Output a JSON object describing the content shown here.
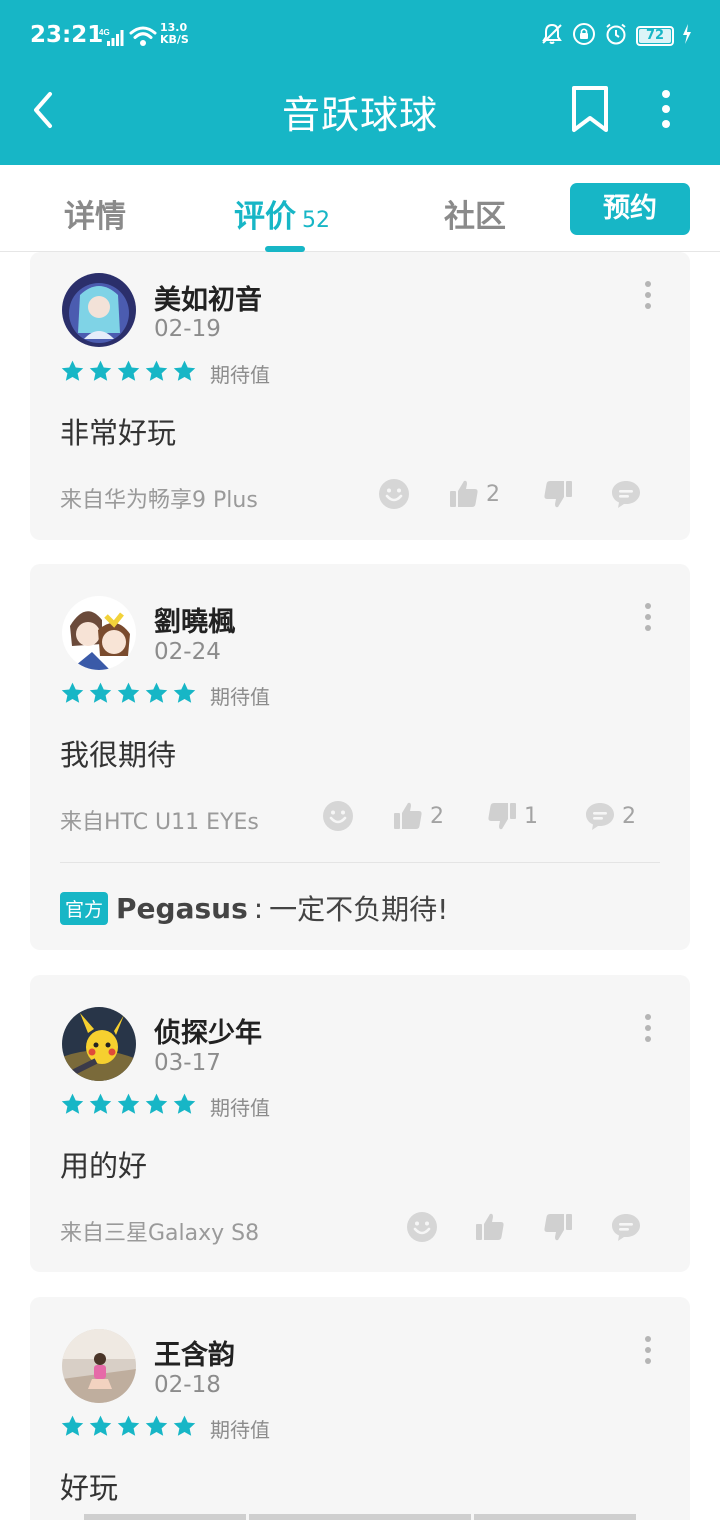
{
  "status_bar": {
    "time": "23:21",
    "network": "4G",
    "speed_value": "13.0",
    "speed_unit": "KB/S",
    "battery": "72"
  },
  "app_bar": {
    "title": "音跃球球"
  },
  "tabs": {
    "details": "详情",
    "reviews": "评价",
    "reviews_count": "52",
    "community": "社区",
    "reserve_button": "预约"
  },
  "reviews": [
    {
      "username": "美如初音",
      "date": "02-19",
      "rating": 5,
      "rating_label": "期待值",
      "text": "非常好玩",
      "device": "来自华为畅享9 Plus",
      "likes": "2",
      "dislikes": "",
      "comments": ""
    },
    {
      "username": "劉曉楓",
      "date": "02-24",
      "rating": 5,
      "rating_label": "期待值",
      "text": "我很期待",
      "device": "来自HTC U11 EYEs",
      "likes": "2",
      "dislikes": "1",
      "comments": "2",
      "official_reply": {
        "badge": "官方",
        "author": "Pegasus",
        "separator": ":",
        "text": "一定不负期待!"
      }
    },
    {
      "username": "侦探少年",
      "date": "03-17",
      "rating": 5,
      "rating_label": "期待值",
      "text": "用的好",
      "device": "来自三星Galaxy S8",
      "likes": "",
      "dislikes": "",
      "comments": ""
    },
    {
      "username": "王含韵",
      "date": "02-18",
      "rating": 5,
      "rating_label": "期待值",
      "text": "好玩"
    }
  ],
  "colors": {
    "accent": "#17b6c6",
    "card_bg": "#f6f6f6",
    "muted": "#9a9a9a"
  }
}
